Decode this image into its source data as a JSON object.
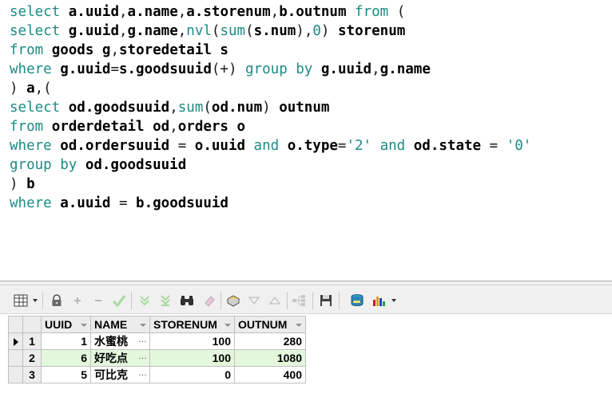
{
  "editor": {
    "lines": [
      [
        [
          "kw",
          "select "
        ],
        [
          "id",
          "a.uuid"
        ],
        [
          "sym",
          ","
        ],
        [
          "id",
          "a.name"
        ],
        [
          "sym",
          ","
        ],
        [
          "id",
          "a.storenum"
        ],
        [
          "sym",
          ","
        ],
        [
          "id",
          "b.outnum"
        ],
        [
          "kw",
          " from "
        ],
        [
          "sym",
          "("
        ]
      ],
      [
        [
          "kw",
          "select "
        ],
        [
          "id",
          "g.uuid"
        ],
        [
          "sym",
          ","
        ],
        [
          "id",
          "g.name"
        ],
        [
          "sym",
          ","
        ],
        [
          "fn",
          "nvl"
        ],
        [
          "sym",
          "("
        ],
        [
          "fn",
          "sum"
        ],
        [
          "sym",
          "("
        ],
        [
          "id",
          "s.num"
        ],
        [
          "sym",
          "),"
        ],
        [
          "num",
          "0"
        ],
        [
          "sym",
          ") "
        ],
        [
          "id",
          "storenum"
        ]
      ],
      [
        [
          "kw",
          "from "
        ],
        [
          "id",
          "goods g"
        ],
        [
          "sym",
          ","
        ],
        [
          "id",
          "storedetail s"
        ]
      ],
      [
        [
          "kw",
          "where "
        ],
        [
          "id",
          "g.uuid"
        ],
        [
          "sym",
          "="
        ],
        [
          "id",
          "s.goodsuuid"
        ],
        [
          "sym",
          "(+) "
        ],
        [
          "kw",
          "group by "
        ],
        [
          "id",
          "g.uuid"
        ],
        [
          "sym",
          ","
        ],
        [
          "id",
          "g.name"
        ]
      ],
      [
        [
          "sym",
          ") "
        ],
        [
          "id",
          "a"
        ],
        [
          "sym",
          ",("
        ]
      ],
      [
        [
          "kw",
          "select "
        ],
        [
          "id",
          "od.goodsuuid"
        ],
        [
          "sym",
          ","
        ],
        [
          "fn",
          "sum"
        ],
        [
          "sym",
          "("
        ],
        [
          "id",
          "od.num"
        ],
        [
          "sym",
          ") "
        ],
        [
          "id",
          "outnum"
        ]
      ],
      [
        [
          "kw",
          "from "
        ],
        [
          "id",
          "orderdetail od"
        ],
        [
          "sym",
          ","
        ],
        [
          "id",
          "orders o"
        ]
      ],
      [
        [
          "kw",
          "where "
        ],
        [
          "id",
          "od.ordersuuid"
        ],
        [
          "sym",
          " = "
        ],
        [
          "id",
          "o.uuid"
        ],
        [
          "kw",
          " and "
        ],
        [
          "id",
          "o.type"
        ],
        [
          "sym",
          "="
        ],
        [
          "str",
          "'2'"
        ],
        [
          "kw",
          " and "
        ],
        [
          "id",
          "od.state"
        ],
        [
          "sym",
          " = "
        ],
        [
          "str",
          "'0'"
        ]
      ],
      [
        [
          "kw",
          "group by "
        ],
        [
          "id",
          "od.goodsuuid"
        ]
      ],
      [
        [
          "sym",
          ") "
        ],
        [
          "id",
          "b"
        ]
      ],
      [
        [
          "kw",
          "where "
        ],
        [
          "id",
          "a.uuid"
        ],
        [
          "sym",
          " = "
        ],
        [
          "id",
          "b.goodsuuid"
        ]
      ]
    ]
  },
  "toolbar": {
    "buttons": [
      {
        "name": "grid-view-icon",
        "state": "enabled"
      },
      {
        "name": "lock-icon",
        "state": "enabled"
      },
      {
        "name": "add-record-icon",
        "state": "disabled"
      },
      {
        "name": "delete-record-icon",
        "state": "disabled"
      },
      {
        "name": "post-changes-icon",
        "state": "disabled"
      },
      {
        "name": "fetch-next-icon",
        "state": "disabled"
      },
      {
        "name": "fetch-last-icon",
        "state": "disabled"
      },
      {
        "name": "find-icon",
        "state": "enabled"
      },
      {
        "name": "clear-icon",
        "state": "disabled"
      },
      {
        "name": "query-by-example-icon",
        "state": "enabled"
      },
      {
        "name": "filter-icon",
        "state": "disabled"
      },
      {
        "name": "sort-icon",
        "state": "disabled"
      },
      {
        "name": "tree-icon",
        "state": "disabled"
      },
      {
        "name": "save-icon",
        "state": "enabled"
      },
      {
        "name": "export-icon",
        "state": "enabled"
      },
      {
        "name": "chart-icon",
        "state": "enabled"
      }
    ]
  },
  "grid": {
    "columns": [
      "UUID",
      "NAME",
      "STORENUM",
      "OUTNUM"
    ],
    "rows": [
      {
        "row_no": "1",
        "uuid": "1",
        "name": "水蜜桃",
        "storenum": "100",
        "outnum": "280",
        "current": true
      },
      {
        "row_no": "2",
        "uuid": "6",
        "name": "好吃点",
        "storenum": "100",
        "outnum": "1080",
        "current": false
      },
      {
        "row_no": "3",
        "uuid": "5",
        "name": "可比克",
        "storenum": "0",
        "outnum": "400",
        "current": false
      }
    ],
    "ellipsis_label": "…"
  },
  "colors": {
    "keyword": "#1d8a84",
    "identifier": "#000000",
    "alt_row": "#e2f7dc",
    "header_bg": "#ececec"
  }
}
